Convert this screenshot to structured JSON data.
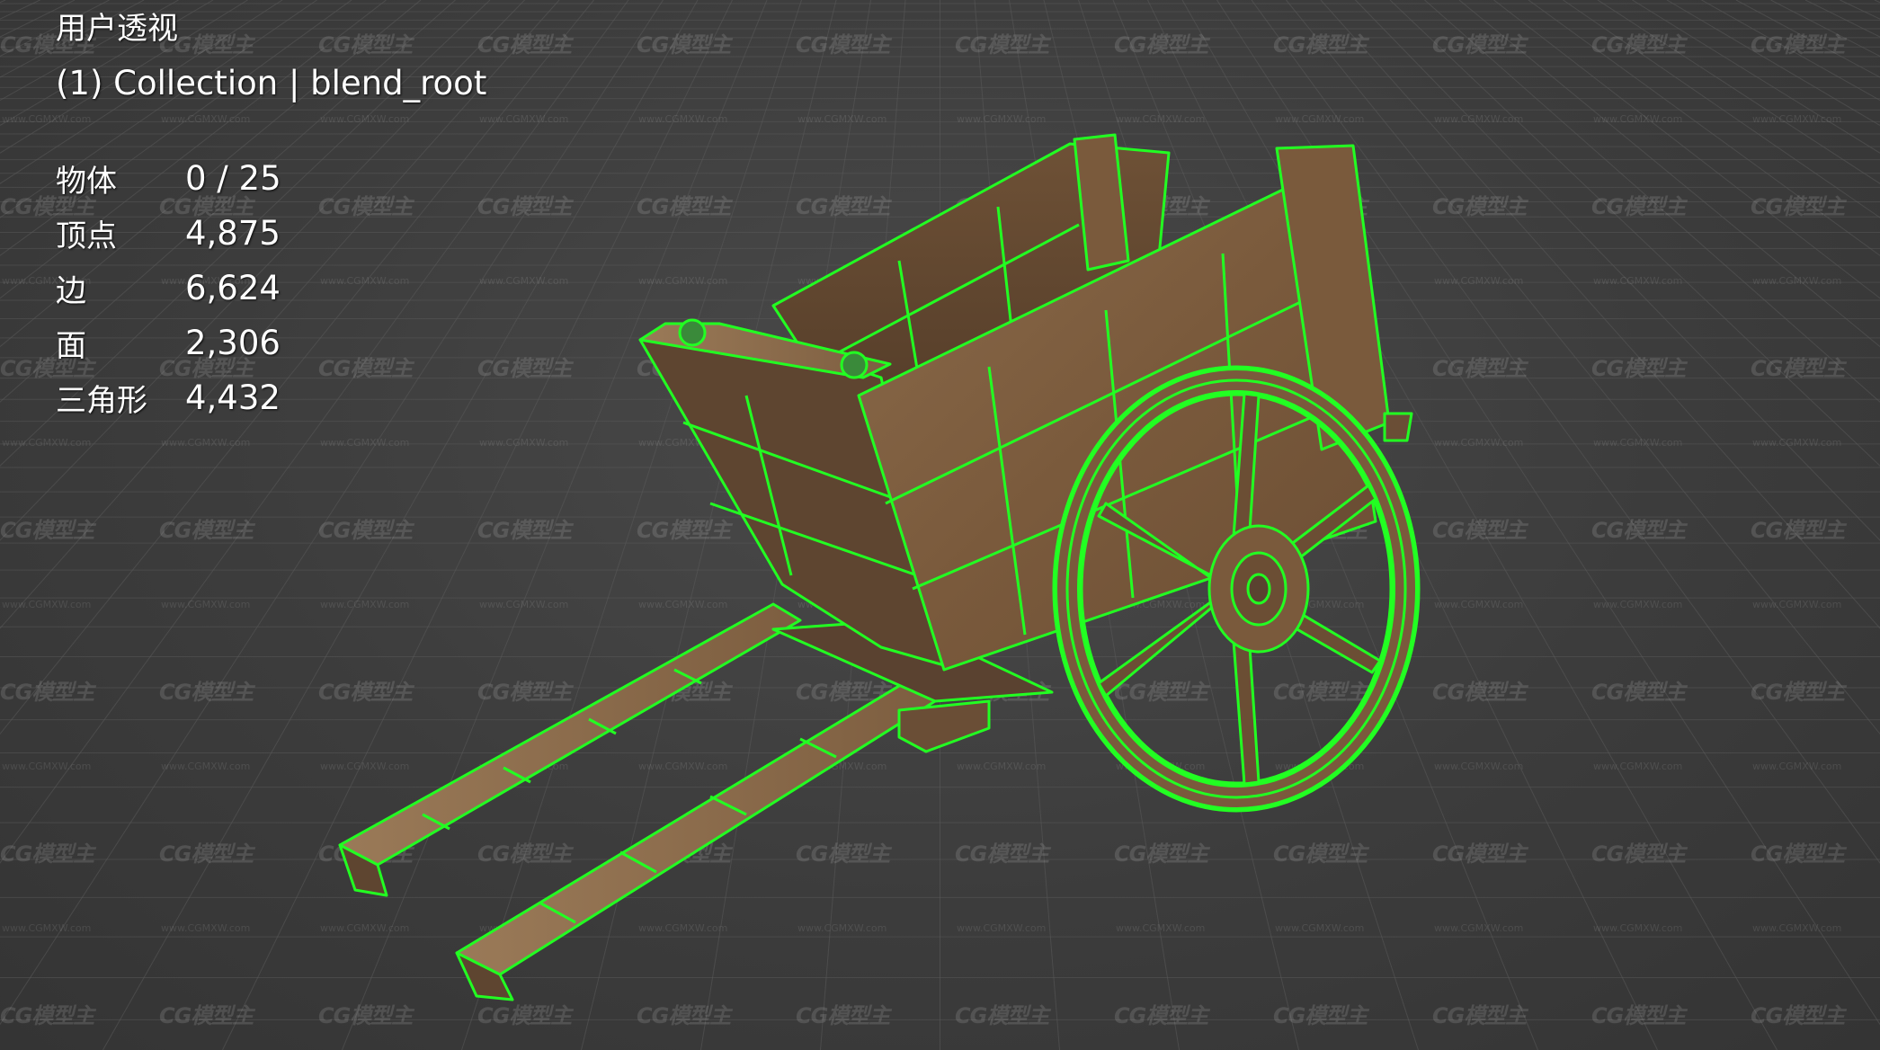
{
  "viewport": {
    "view_title": "用户透视",
    "collection_label": "(1) Collection | blend_root",
    "background_color": "#3d3d3d",
    "grid_color": "#5a5a5a",
    "wireframe_color": "#22ff22"
  },
  "stats": [
    {
      "label": "物体",
      "value": "0 / 25"
    },
    {
      "label": "顶点",
      "value": "4,875"
    },
    {
      "label": "边",
      "value": "6,624"
    },
    {
      "label": "面",
      "value": "2,306"
    },
    {
      "label": "三角形",
      "value": "4,432"
    }
  ],
  "watermark": {
    "logo_text": "CG模型主",
    "url_text": "www.CGMXW.com"
  },
  "scene": {
    "object": "wooden-cart",
    "icons": [
      "cart-model"
    ]
  }
}
